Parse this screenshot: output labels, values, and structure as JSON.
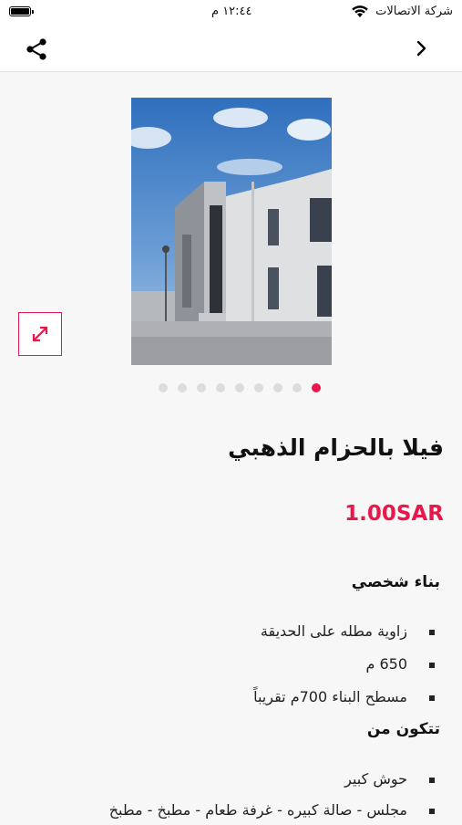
{
  "status_bar": {
    "carrier": "شركة الاتصالات",
    "time": "١٢:٤٤ م"
  },
  "nav": {
    "share_icon": "share-icon",
    "back_icon": "chevron-right-icon"
  },
  "gallery": {
    "image_count": 9,
    "active_index": 0,
    "expand_icon": "expand-icon"
  },
  "product": {
    "title": "فيلا بالحزام الذهبي",
    "price": "1.00SAR"
  },
  "description": {
    "section1_heading": "بناء شخصي",
    "section1_items": [
      "زاوية مطله على الحديقة",
      "650 م",
      "مسطح البناء 700م تقريباً"
    ],
    "section2_heading": "تتكون من",
    "section2_items": [
      "حوش كبير",
      "مجلس - صالة كبيره - غرفة طعام - مطبخ - مطبخ"
    ]
  },
  "colors": {
    "accent": "#e8194a",
    "background": "#f7f7f7"
  }
}
